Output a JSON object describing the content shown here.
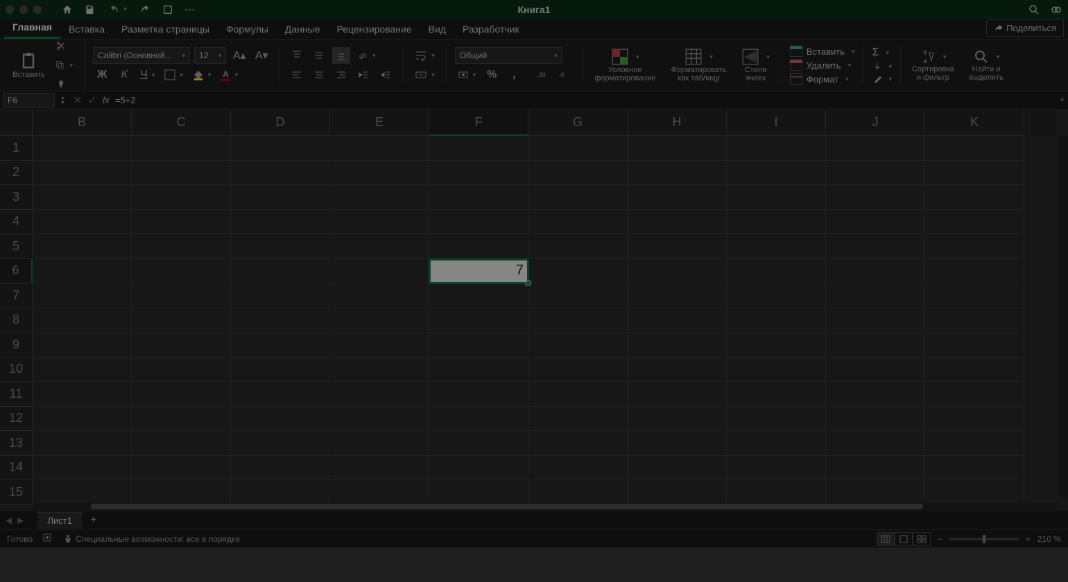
{
  "title": "Книга1",
  "tabs": [
    "Главная",
    "Вставка",
    "Разметка страницы",
    "Формулы",
    "Данные",
    "Рецензирование",
    "Вид",
    "Разработчик"
  ],
  "active_tab": 0,
  "share": "Поделиться",
  "ribbon": {
    "paste": "Вставить",
    "font_name": "Calibri (Основной...",
    "font_size": "12",
    "number_format": "Общий",
    "cond_fmt_l1": "Условное",
    "cond_fmt_l2": "форматирование",
    "fmt_table_l1": "Форматировать",
    "fmt_table_l2": "как таблицу",
    "styles_l1": "Стили",
    "styles_l2": "ячеек",
    "insert": "Вставить",
    "delete": "Удалить",
    "format": "Формат",
    "sort_l1": "Сортировка",
    "sort_l2": "и фильтр",
    "find_l1": "Найти и",
    "find_l2": "выделить"
  },
  "formula_bar": {
    "cell_ref": "F6",
    "fx": "fx",
    "formula": "=5+2"
  },
  "grid": {
    "columns": [
      "B",
      "C",
      "D",
      "E",
      "F",
      "G",
      "H",
      "I",
      "J",
      "K"
    ],
    "rows": [
      "1",
      "2",
      "3",
      "4",
      "5",
      "6",
      "7",
      "8",
      "9",
      "10",
      "11",
      "12",
      "13",
      "14",
      "15"
    ],
    "selected_col": "F",
    "selected_row": "6",
    "selected_value": "7"
  },
  "sheet_tab": "Лист1",
  "status": {
    "ready": "Готово",
    "accessibility": "Специальные возможности: все в порядке",
    "zoom": "210 %"
  }
}
